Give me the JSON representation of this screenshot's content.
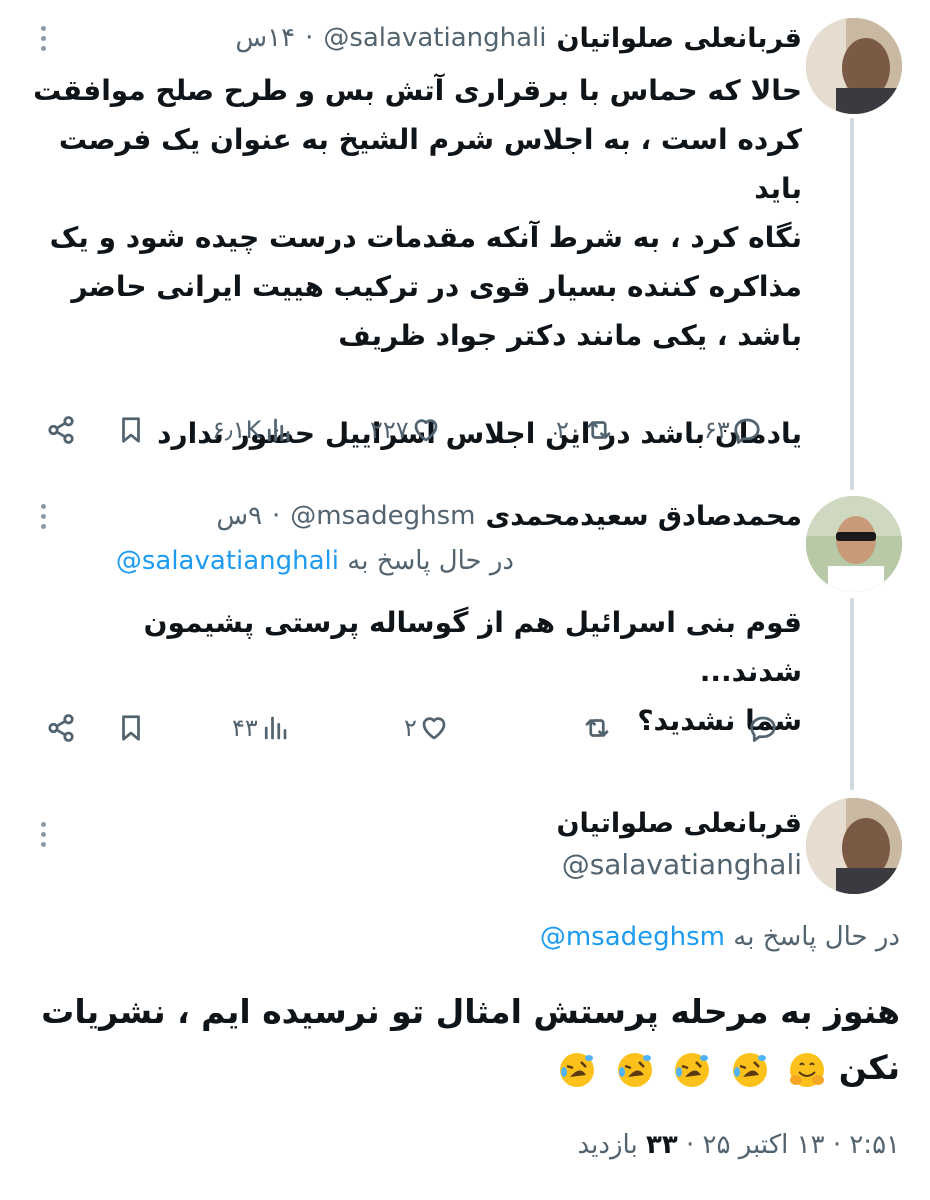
{
  "tweets": [
    {
      "author_name": "قربانعلی صلواتیان",
      "handle": "@salavatianghali",
      "separator": "·",
      "time": "۱۴س",
      "text_lines": [
        "حالا که حماس با برقراری آتش بس و طرح صلح موافقت",
        "کرده است ، به اجلاس شرم الشیخ به عنوان یک فرصت باید",
        "نگاه کرد ، به شرط آنکه مقدمات درست چیده شود و یک",
        "مذاکره کننده بسیار قوی در ترکیب هییت ایرانی حاضر",
        "باشد ، یکی مانند دکتر جواد ظریف",
        "",
        "یادمان باشد در این اجلاس اسراییل حضور ندارد"
      ],
      "actions": {
        "replies": "۶۳",
        "retweets": "۲۰",
        "likes": "۲۲۷",
        "views": "۶٫۱K"
      }
    },
    {
      "author_name": "محمدصادق سعیدمحمدی",
      "handle": "@msadeghsm",
      "separator": "·",
      "time": "۹س",
      "reply_prefix": "در حال پاسخ به",
      "reply_mention": "@salavatianghali",
      "text_lines": [
        "قوم بنی اسرائیل هم از گوساله پرستی پشیمون شدند...",
        "شما نشدید؟"
      ],
      "actions": {
        "replies": "",
        "retweets": "",
        "likes": "۲",
        "views": "۴۳"
      }
    }
  ],
  "main_tweet": {
    "author_name": "قربانعلی صلواتیان",
    "handle": "@salavatianghali",
    "reply_prefix": "در حال پاسخ به",
    "reply_mention": "@msadeghsm",
    "text_line1": "هنوز به مرحله پرستش امثال تو نرسیده ایم ، نشریات",
    "text_line2": "نکن",
    "time": "۲:۵۱",
    "separator": "·",
    "date": "۱۳ اکتبر ۲۵",
    "views_count": "۳۳",
    "views_label": "بازدید"
  },
  "colors": {
    "accent": "#1d9bf0",
    "muted": "#536471",
    "text": "#0f1419",
    "thread": "#cfd9de"
  },
  "icons": [
    "share-icon",
    "bookmark-icon",
    "views-icon",
    "heart-icon",
    "retweet-icon",
    "reply-icon",
    "more-icon"
  ]
}
